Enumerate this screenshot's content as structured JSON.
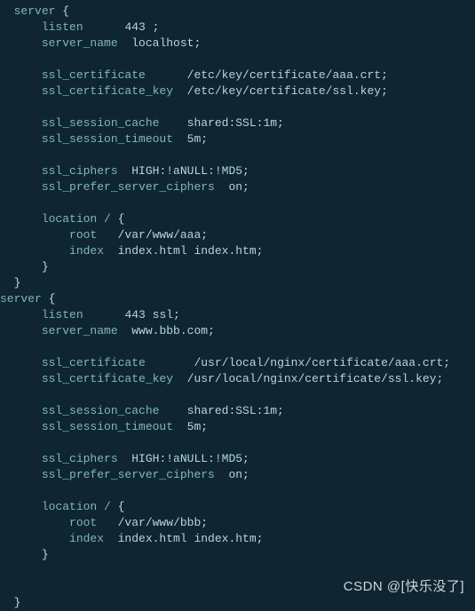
{
  "code": {
    "lines": [
      {
        "indent": 2,
        "tokens": [
          {
            "t": "server ",
            "c": "kw"
          },
          {
            "t": "{",
            "c": "punct"
          }
        ]
      },
      {
        "indent": 6,
        "tokens": [
          {
            "t": "listen      ",
            "c": "kw"
          },
          {
            "t": "443 ;",
            "c": "arg"
          }
        ]
      },
      {
        "indent": 6,
        "tokens": [
          {
            "t": "server_name  ",
            "c": "kw"
          },
          {
            "t": "localhost;",
            "c": "arg"
          }
        ]
      },
      {
        "indent": 0,
        "tokens": []
      },
      {
        "indent": 6,
        "tokens": [
          {
            "t": "ssl_certificate      ",
            "c": "kw"
          },
          {
            "t": "/etc/key/certificate/aaa.crt;",
            "c": "arg"
          }
        ]
      },
      {
        "indent": 6,
        "tokens": [
          {
            "t": "ssl_certificate_key  ",
            "c": "kw"
          },
          {
            "t": "/etc/key/certificate/ssl.key;",
            "c": "arg"
          }
        ]
      },
      {
        "indent": 0,
        "tokens": []
      },
      {
        "indent": 6,
        "tokens": [
          {
            "t": "ssl_session_cache    ",
            "c": "kw"
          },
          {
            "t": "shared:SSL:1m;",
            "c": "arg"
          }
        ]
      },
      {
        "indent": 6,
        "tokens": [
          {
            "t": "ssl_session_timeout  ",
            "c": "kw"
          },
          {
            "t": "5m;",
            "c": "arg"
          }
        ]
      },
      {
        "indent": 0,
        "tokens": []
      },
      {
        "indent": 6,
        "tokens": [
          {
            "t": "ssl_ciphers  ",
            "c": "kw"
          },
          {
            "t": "HIGH:!aNULL:!MD5;",
            "c": "arg"
          }
        ]
      },
      {
        "indent": 6,
        "tokens": [
          {
            "t": "ssl_prefer_server_ciphers  ",
            "c": "kw"
          },
          {
            "t": "on;",
            "c": "arg"
          }
        ]
      },
      {
        "indent": 0,
        "tokens": []
      },
      {
        "indent": 6,
        "tokens": [
          {
            "t": "location / ",
            "c": "kw"
          },
          {
            "t": "{",
            "c": "punct"
          }
        ]
      },
      {
        "indent": 10,
        "tokens": [
          {
            "t": "root   ",
            "c": "kw"
          },
          {
            "t": "/var/www/aaa;",
            "c": "arg"
          }
        ]
      },
      {
        "indent": 10,
        "tokens": [
          {
            "t": "index  ",
            "c": "kw"
          },
          {
            "t": "index.html index.htm;",
            "c": "arg"
          }
        ]
      },
      {
        "indent": 6,
        "tokens": [
          {
            "t": "}",
            "c": "punct"
          }
        ]
      },
      {
        "indent": 2,
        "tokens": [
          {
            "t": "}",
            "c": "punct"
          }
        ]
      },
      {
        "indent": 0,
        "tokens": [
          {
            "t": "server ",
            "c": "kw"
          },
          {
            "t": "{",
            "c": "punct"
          }
        ]
      },
      {
        "indent": 6,
        "tokens": [
          {
            "t": "listen      ",
            "c": "kw"
          },
          {
            "t": "443 ssl;",
            "c": "arg"
          }
        ]
      },
      {
        "indent": 6,
        "tokens": [
          {
            "t": "server_name  ",
            "c": "kw"
          },
          {
            "t": "www.bbb.com;",
            "c": "arg"
          }
        ]
      },
      {
        "indent": 0,
        "tokens": []
      },
      {
        "indent": 6,
        "tokens": [
          {
            "t": "ssl_certificate       ",
            "c": "kw"
          },
          {
            "t": "/usr/local/nginx/certificate/aaa.crt;",
            "c": "arg"
          }
        ]
      },
      {
        "indent": 6,
        "tokens": [
          {
            "t": "ssl_certificate_key  ",
            "c": "kw"
          },
          {
            "t": "/usr/local/nginx/certificate/ssl.key;",
            "c": "arg"
          }
        ]
      },
      {
        "indent": 0,
        "tokens": []
      },
      {
        "indent": 6,
        "tokens": [
          {
            "t": "ssl_session_cache    ",
            "c": "kw"
          },
          {
            "t": "shared:SSL:1m;",
            "c": "arg"
          }
        ]
      },
      {
        "indent": 6,
        "tokens": [
          {
            "t": "ssl_session_timeout  ",
            "c": "kw"
          },
          {
            "t": "5m;",
            "c": "arg"
          }
        ]
      },
      {
        "indent": 0,
        "tokens": []
      },
      {
        "indent": 6,
        "tokens": [
          {
            "t": "ssl_ciphers  ",
            "c": "kw"
          },
          {
            "t": "HIGH:!aNULL:!MD5;",
            "c": "arg"
          }
        ]
      },
      {
        "indent": 6,
        "tokens": [
          {
            "t": "ssl_prefer_server_ciphers  ",
            "c": "kw"
          },
          {
            "t": "on;",
            "c": "arg"
          }
        ]
      },
      {
        "indent": 0,
        "tokens": []
      },
      {
        "indent": 6,
        "tokens": [
          {
            "t": "location / ",
            "c": "kw"
          },
          {
            "t": "{",
            "c": "punct"
          }
        ]
      },
      {
        "indent": 10,
        "tokens": [
          {
            "t": "root   ",
            "c": "kw"
          },
          {
            "t": "/var/www/bbb;",
            "c": "arg"
          }
        ]
      },
      {
        "indent": 10,
        "tokens": [
          {
            "t": "index  ",
            "c": "kw"
          },
          {
            "t": "index.html index.htm;",
            "c": "arg"
          }
        ]
      },
      {
        "indent": 6,
        "tokens": [
          {
            "t": "}",
            "c": "punct"
          }
        ]
      },
      {
        "indent": 0,
        "tokens": []
      },
      {
        "indent": 0,
        "tokens": []
      },
      {
        "indent": 2,
        "tokens": [
          {
            "t": "}",
            "c": "punct"
          }
        ]
      }
    ]
  },
  "watermark": "CSDN @[快乐没了]"
}
